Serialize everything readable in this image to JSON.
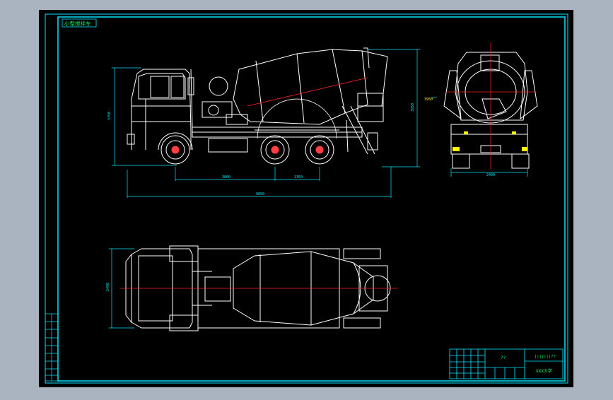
{
  "drawing": {
    "title_tag": "小型搅拌车",
    "title_block": {
      "name": "??",
      "drawing_no": "|||||||??",
      "company": "XXX大学"
    },
    "side_view": {
      "height_dim": "3350",
      "overall_length_dim": "9850",
      "wheelbase_front_dim": "3800",
      "wheelbase_rear_dim": "1350",
      "drum_height_dim": "3950"
    },
    "rear_view": {
      "width_dim": "2490",
      "top_dim": "3950"
    },
    "top_view": {
      "width_dim": "2490"
    }
  },
  "colors": {
    "background": "#000000",
    "frame": "#00ffff",
    "geometry": "#ffffff",
    "centerline": "#ff2020",
    "dimension": "#00ffff",
    "highlight": "#ffff00"
  }
}
